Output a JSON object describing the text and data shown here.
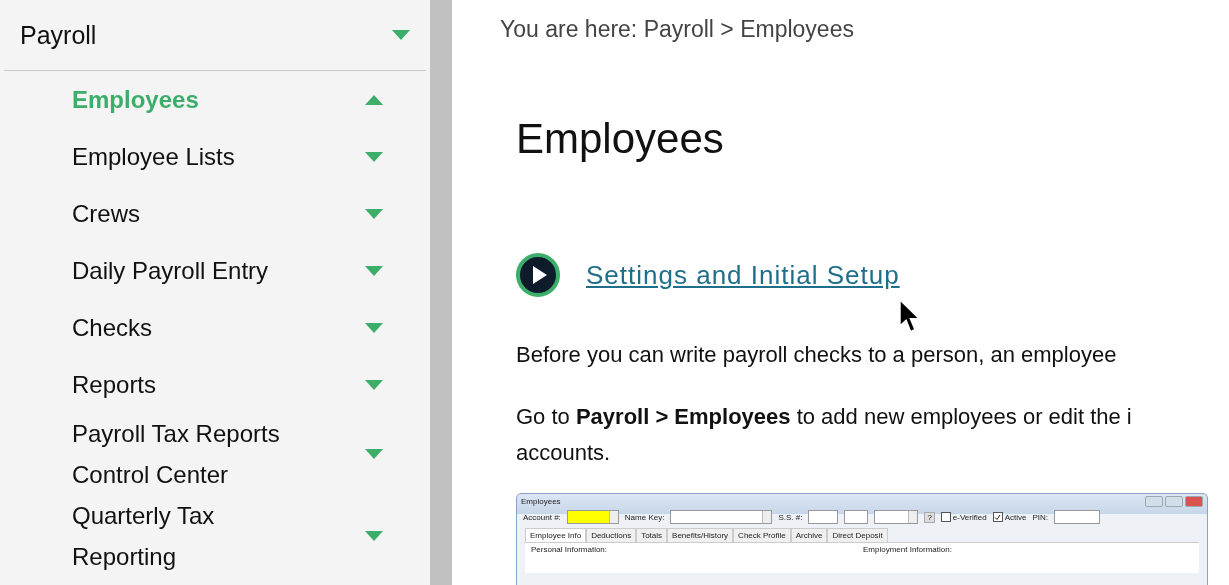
{
  "sidebar": {
    "section": {
      "label": "Payroll",
      "expanded": false
    },
    "items": [
      {
        "label": "Employees",
        "selected": true,
        "expanded": true
      },
      {
        "label": "Employee Lists",
        "selected": false,
        "expanded": false
      },
      {
        "label": "Crews",
        "selected": false,
        "expanded": false
      },
      {
        "label": "Daily Payroll Entry",
        "selected": false,
        "expanded": false
      },
      {
        "label": "Checks",
        "selected": false,
        "expanded": false
      },
      {
        "label": "Reports",
        "selected": false,
        "expanded": false
      },
      {
        "label": "Payroll Tax Reports Control Center",
        "selected": false,
        "expanded": false
      },
      {
        "label": "Quarterly Tax Reporting",
        "selected": false,
        "expanded": false
      }
    ]
  },
  "breadcrumb": "You are here: Payroll > Employees",
  "title": "Employees",
  "video_link": "Settings and Initial Setup",
  "paragraphs": [
    {
      "lines": [
        "Before you can write payroll checks to a person, an employee"
      ]
    },
    {
      "lines": [
        "Go to **Payroll > Employees** to add new employees or edit the i",
        "accounts."
      ]
    }
  ],
  "screenshot": {
    "title": "Employees",
    "fields": [
      {
        "kind": "input",
        "label": "Account #:",
        "highlighted": true,
        "dropdown": true
      },
      {
        "kind": "input",
        "label": "Name Key:",
        "highlighted": false,
        "dropdown": true
      },
      {
        "kind": "ssn",
        "label": "S.S. #:",
        "help": "?"
      },
      {
        "kind": "checkbox",
        "label": "e-Verified",
        "checked": false
      },
      {
        "kind": "checkbox",
        "label": "Active",
        "checked": true
      },
      {
        "kind": "input",
        "label": "PIN:",
        "highlighted": false,
        "dropdown": false
      }
    ],
    "tabs": [
      {
        "label": "Employee Info",
        "selected": true
      },
      {
        "label": "Deductions",
        "selected": false
      },
      {
        "label": "Totals",
        "selected": false
      },
      {
        "label": "Benefits/History",
        "selected": false
      },
      {
        "label": "Check Profile",
        "selected": false
      },
      {
        "label": "Archive",
        "selected": false
      },
      {
        "label": "Direct Deposit",
        "selected": false
      }
    ],
    "groups": [
      "Personal Information:",
      "Employment Information:"
    ]
  }
}
